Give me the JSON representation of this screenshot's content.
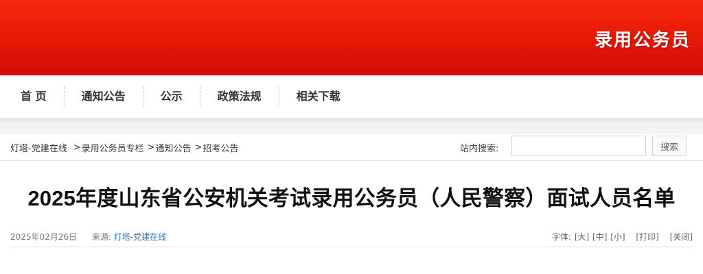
{
  "header": {
    "banner_title": "录用公务员",
    "colors": {
      "banner_top": "#f52a0c",
      "banner_bottom": "#d40c05",
      "banner_text": "#ffffff"
    }
  },
  "nav": {
    "items": [
      {
        "label": "首 页"
      },
      {
        "label": "通知公告"
      },
      {
        "label": "公示"
      },
      {
        "label": "政策法规"
      },
      {
        "label": "相关下载"
      }
    ]
  },
  "breadcrumb": {
    "items": [
      "灯塔-党建在线",
      "录用公务员专栏",
      "通知公告",
      "招考公告"
    ],
    "separator": ">"
  },
  "search": {
    "label": "站内搜索:",
    "input_value": "",
    "button_label": "搜索"
  },
  "article": {
    "title": "2025年度山东省公安机关考试录用公务员（人民警察）面试人员名单",
    "date": "2025年02月26日",
    "source_label": "来源:",
    "source_value": "灯塔-党建在线",
    "source_color": "#2f6fb0",
    "font_label": "字体:",
    "font_large": "[大]",
    "font_medium": "[中]",
    "font_small": "[小]",
    "print_label": "[打印]",
    "close_label": "[关闭]"
  }
}
